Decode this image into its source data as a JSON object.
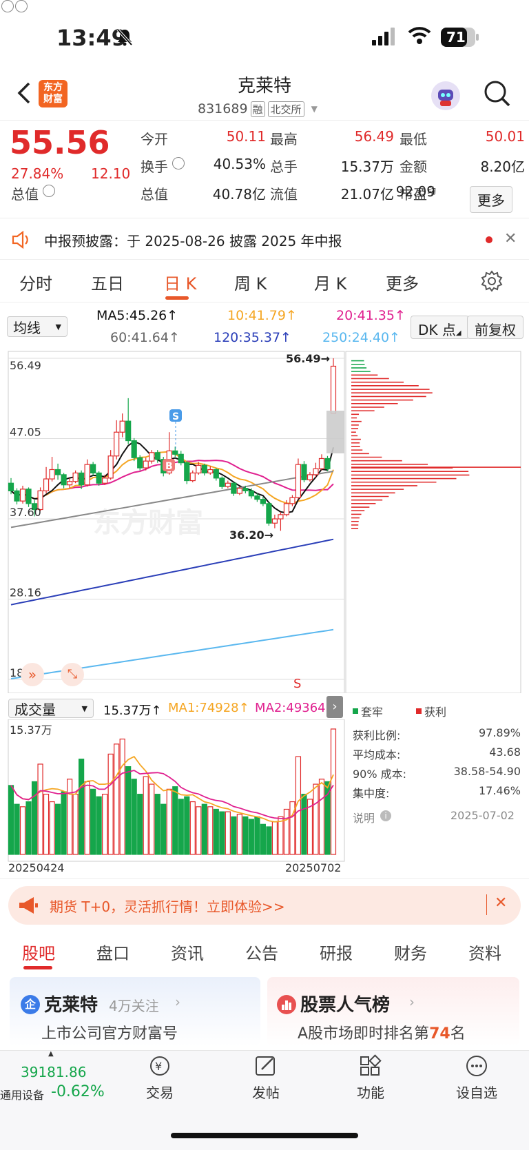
{
  "status": {
    "time": "13:49",
    "battery": "71"
  },
  "header": {
    "title": "克莱特",
    "code": "831689",
    "tag_margin": "融",
    "tag_exchange": "北交所",
    "logo_line1": "东方",
    "logo_line2": "财富"
  },
  "quote": {
    "price": "55.56",
    "change_pct": "27.84%",
    "change": "12.10",
    "fields": [
      {
        "label": "今开",
        "value": "50.11",
        "color": "#e02a2a"
      },
      {
        "label": "最高",
        "value": "56.49",
        "color": "#e02a2a"
      },
      {
        "label": "最低",
        "value": "50.01",
        "color": "#e02a2a"
      },
      {
        "label": "换手",
        "value": "40.53%",
        "color": "#222"
      },
      {
        "label": "总手",
        "value": "15.37万",
        "color": "#222"
      },
      {
        "label": "金额",
        "value": "8.20亿",
        "color": "#222"
      },
      {
        "label": "总值",
        "value": "40.78亿",
        "color": "#222"
      },
      {
        "label": "流值",
        "value": "21.07亿",
        "color": "#222"
      },
      {
        "label": "市盈",
        "value": "92.09",
        "color": "#222"
      }
    ],
    "pe_superscript": "动",
    "more_label": "更多"
  },
  "notice": {
    "text": "中报预披露：于 2025-08-26 披露 2025 年中报"
  },
  "chart_tabs": [
    "分时",
    "五日",
    "日 K",
    "周 K",
    "月 K",
    "更多"
  ],
  "active_tab": "日 K",
  "ma_panel": {
    "selector": "均线",
    "ma5": "MA5:45.26↑",
    "ma10": "10:41.79↑",
    "ma20": "20:41.35↑",
    "ma60": "60:41.64↑",
    "ma120": "120:35.37↑",
    "ma250": "250:24.40↑",
    "dk_label": "DK 点",
    "adjust_label": "前复权"
  },
  "kline": {
    "axis_labels": [
      "56.49",
      "47.05",
      "37.60",
      "28.16",
      "18.72"
    ],
    "high_marker": "56.49→",
    "low_marker": "36.20→",
    "s_badge": "S",
    "b_badge": "B",
    "s_signal": "S",
    "watermark": "东方财富"
  },
  "volume": {
    "selector": "成交量",
    "vol": "15.37万↑",
    "ma1": "MA1:74928↑",
    "ma2": "MA2:49364↑",
    "axis_top": "15.37万",
    "date_start": "20250424",
    "date_end": "20250702"
  },
  "chips": {
    "legend_firm": "套牢",
    "legend_profit": "获利",
    "stats": [
      {
        "label": "获利比例:",
        "value": "97.89%"
      },
      {
        "label": "平均成本:",
        "value": "43.68"
      },
      {
        "label": "90% 成本:",
        "value": "38.58-54.90"
      },
      {
        "label": "集中度:",
        "value": "17.46%"
      }
    ],
    "note_label": "说明",
    "note_date": "2025-07-02"
  },
  "ad": {
    "text": "期货 T+0，灵活抓行情！立即体验>>"
  },
  "bottom_tabs": [
    "股吧",
    "盘口",
    "资讯",
    "公告",
    "研报",
    "财务",
    "资料"
  ],
  "cards": [
    {
      "title": "克莱特",
      "sub": "4万关注",
      "desc": "上市公司官方财富号"
    },
    {
      "title": "股票人气榜",
      "sub": "",
      "desc_prefix": "A股市场即时排名第",
      "rank": "74",
      "desc_suffix": "名"
    }
  ],
  "bottom_nav": {
    "index_value": "39181.86",
    "index_name": "通用设备",
    "index_change": "-0.62%",
    "items": [
      "交易",
      "发帖",
      "功能",
      "设自选"
    ]
  },
  "chart_data": {
    "type": "candlestick",
    "x_start": "20250424",
    "x_end": "20250702",
    "ylim": [
      18.72,
      56.49
    ],
    "candles": [
      [
        41.8,
        40.9,
        42.4,
        40.5
      ],
      [
        40.9,
        39.7,
        41.2,
        39.3
      ],
      [
        39.7,
        41.1,
        41.5,
        39.4
      ],
      [
        41.1,
        39.4,
        41.3,
        39.0
      ],
      [
        39.4,
        38.7,
        39.8,
        37.9
      ],
      [
        38.7,
        40.9,
        41.3,
        38.5
      ],
      [
        40.9,
        42.3,
        43.7,
        40.6
      ],
      [
        42.3,
        43.4,
        44.9,
        42.0
      ],
      [
        43.4,
        42.8,
        44.1,
        42.2
      ],
      [
        42.8,
        41.6,
        43.0,
        41.2
      ],
      [
        41.6,
        42.0,
        42.4,
        41.2
      ],
      [
        42.0,
        43.0,
        43.3,
        41.8
      ],
      [
        43.0,
        41.6,
        43.3,
        41.1
      ],
      [
        41.6,
        44.0,
        44.6,
        41.4
      ],
      [
        44.0,
        43.0,
        44.3,
        42.7
      ],
      [
        43.0,
        41.8,
        43.2,
        41.5
      ],
      [
        41.8,
        42.4,
        42.8,
        41.6
      ],
      [
        42.4,
        45.0,
        45.7,
        42.2
      ],
      [
        45.0,
        47.8,
        49.2,
        44.6
      ],
      [
        47.8,
        49.1,
        50.0,
        47.2
      ],
      [
        49.1,
        46.8,
        51.8,
        46.4
      ],
      [
        46.8,
        44.8,
        47.1,
        44.4
      ],
      [
        44.8,
        43.6,
        45.1,
        43.3
      ],
      [
        43.6,
        44.4,
        44.8,
        43.3
      ],
      [
        44.4,
        45.4,
        45.7,
        44.1
      ],
      [
        45.4,
        44.6,
        45.7,
        44.2
      ],
      [
        44.6,
        43.0,
        44.9,
        42.6
      ],
      [
        43.0,
        45.6,
        47.8,
        42.8
      ],
      [
        45.6,
        45.2,
        46.1,
        44.9
      ],
      [
        45.2,
        44.2,
        45.6,
        43.9
      ],
      [
        44.2,
        42.1,
        44.4,
        41.7
      ],
      [
        42.1,
        43.0,
        43.3,
        41.9
      ],
      [
        43.0,
        43.9,
        44.3,
        42.8
      ],
      [
        43.9,
        43.0,
        44.1,
        42.7
      ],
      [
        43.0,
        43.4,
        43.8,
        42.8
      ],
      [
        43.4,
        42.4,
        43.6,
        42.1
      ],
      [
        42.4,
        41.4,
        42.6,
        41.1
      ],
      [
        41.4,
        41.8,
        42.1,
        41.2
      ],
      [
        41.8,
        40.6,
        41.9,
        40.3
      ],
      [
        40.6,
        41.2,
        41.4,
        40.4
      ],
      [
        41.2,
        40.9,
        41.5,
        40.6
      ],
      [
        40.9,
        40.3,
        41.2,
        40.0
      ],
      [
        40.3,
        39.9,
        40.6,
        39.6
      ],
      [
        39.9,
        39.4,
        40.2,
        39.1
      ],
      [
        39.4,
        37.1,
        39.6,
        36.8
      ],
      [
        37.1,
        37.6,
        38.1,
        36.5
      ],
      [
        37.6,
        38.1,
        38.4,
        36.2
      ],
      [
        38.1,
        39.4,
        39.8,
        37.9
      ],
      [
        39.4,
        40.1,
        40.4,
        39.1
      ],
      [
        40.1,
        44.0,
        44.7,
        39.9
      ],
      [
        44.0,
        42.2,
        44.4,
        41.9
      ],
      [
        42.2,
        42.8,
        43.1,
        42.0
      ],
      [
        42.8,
        43.5,
        44.2,
        42.5
      ],
      [
        43.5,
        44.7,
        45.2,
        43.3
      ],
      [
        44.7,
        43.5,
        45.0,
        43.2
      ],
      [
        50.01,
        55.56,
        56.49,
        50.01
      ]
    ]
  }
}
